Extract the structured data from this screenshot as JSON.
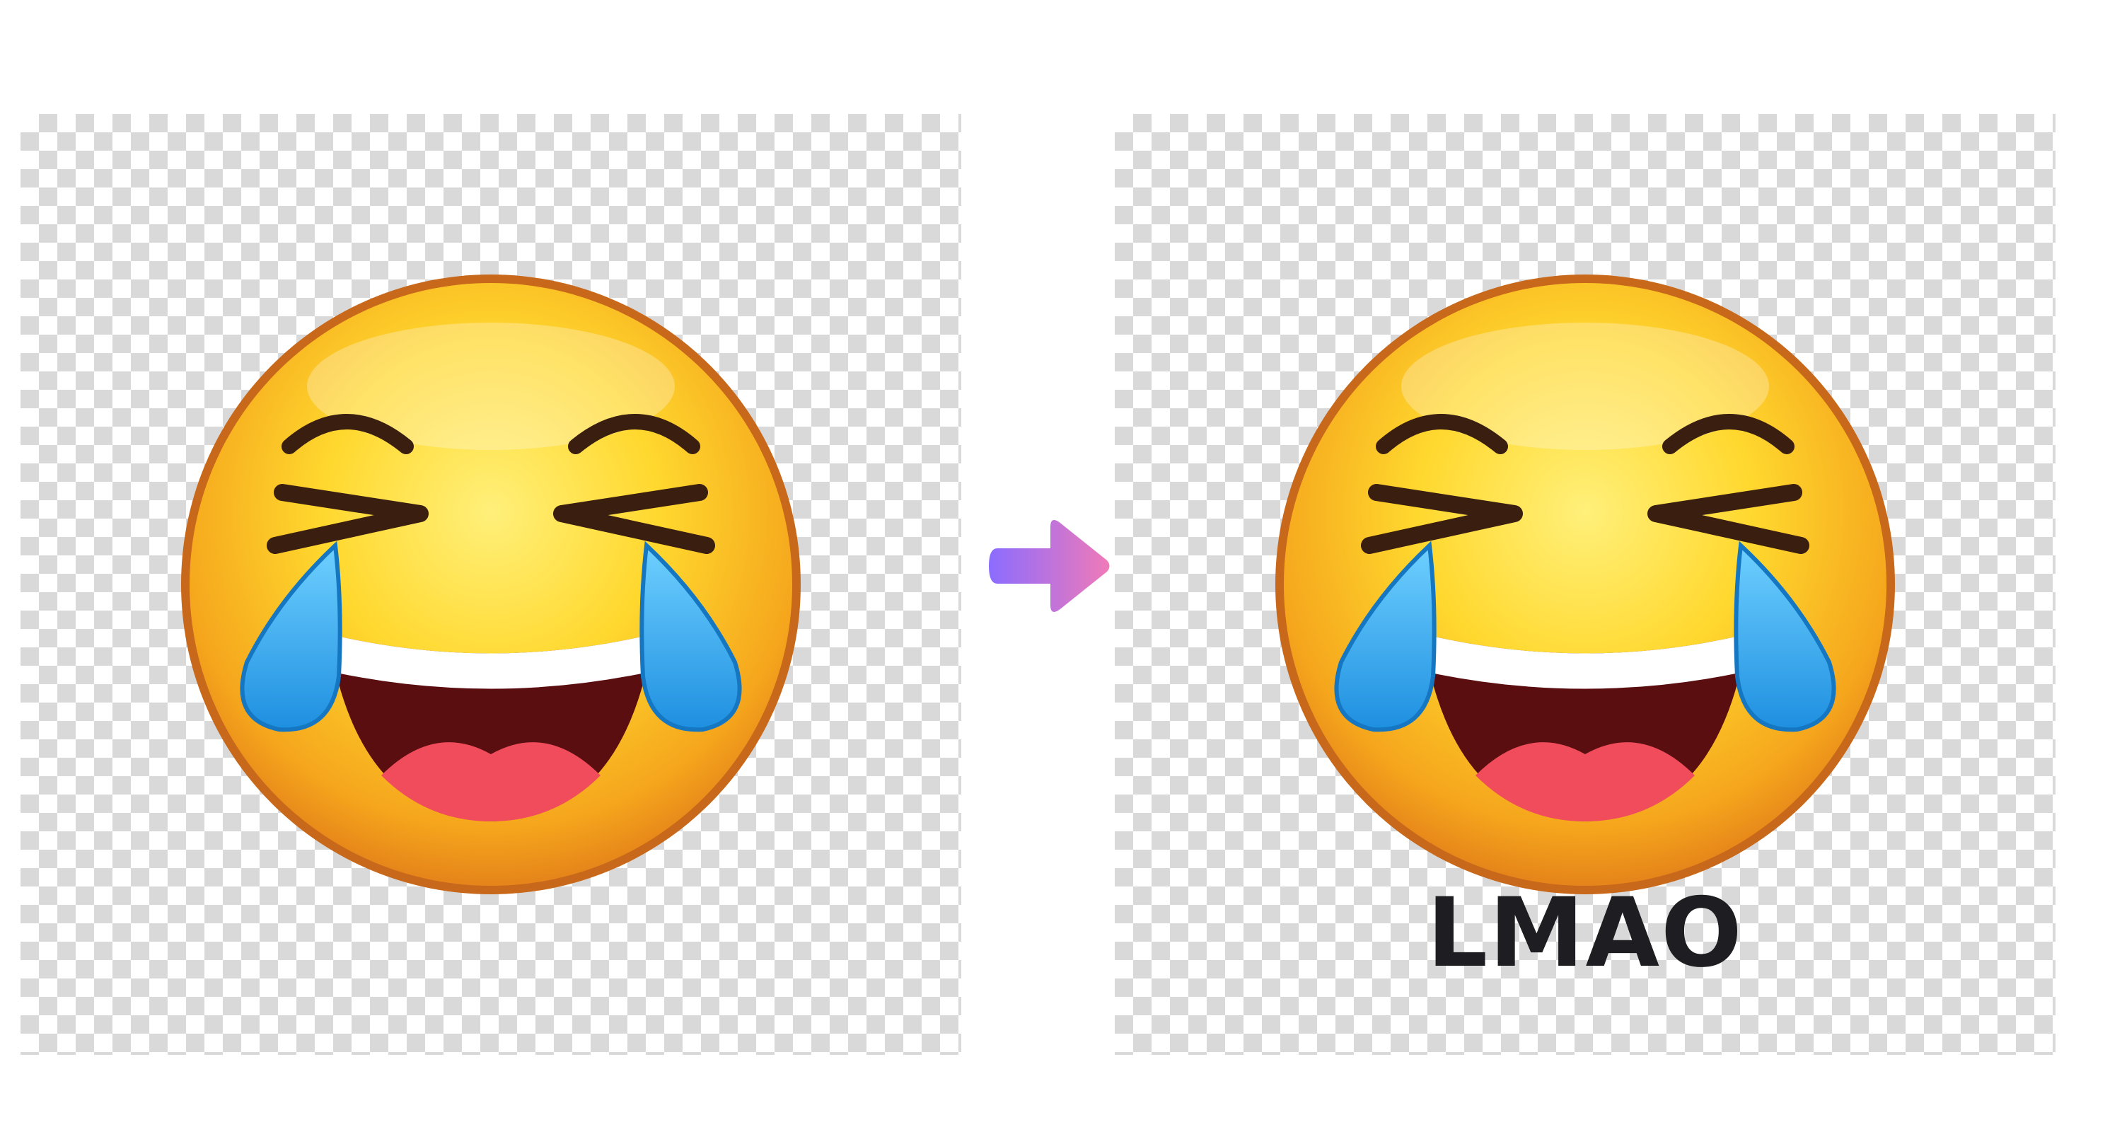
{
  "before": {
    "icon": "face-with-tears-of-joy-emoji"
  },
  "transition": {
    "icon": "arrow-right-icon",
    "gradient": [
      "#8b6cff",
      "#f07ab8"
    ]
  },
  "after": {
    "icon": "face-with-tears-of-joy-emoji",
    "caption": "LMAO",
    "caption_color": "#1e1e22"
  },
  "colors": {
    "face_light": "#ffe45a",
    "face_dark": "#f0a418",
    "face_rim": "#d8761a",
    "tear": "#2aa3ea",
    "mouth": "#5a0e10",
    "tongue": "#f04c5c",
    "teeth": "#ffffff",
    "eyes": "#3a1f10",
    "checker": "#d9d9d9"
  }
}
